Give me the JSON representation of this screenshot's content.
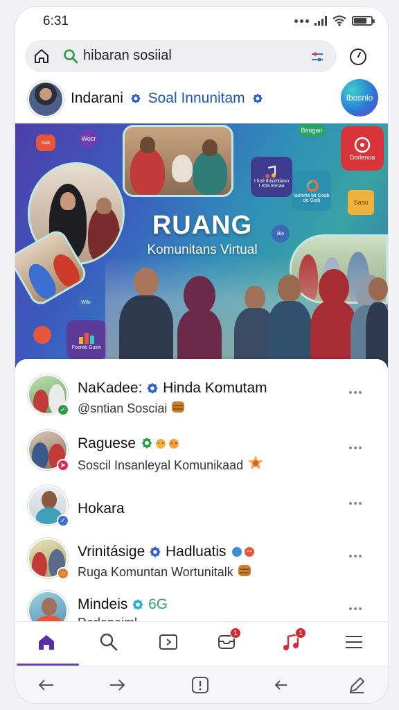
{
  "status": {
    "time": "6:31"
  },
  "search": {
    "query": "hibaran sosiial"
  },
  "profile": {
    "name": "Indarani",
    "subtitle": "Soal Innunitam",
    "brand_label": "Ibosnio"
  },
  "hero": {
    "title": "RUANG",
    "subtitle": "Komunitans Virtual",
    "chips": [
      {
        "label": "Wocr",
        "color": "#6a3fb6"
      },
      {
        "label": "Beogan",
        "color": "#2aa36b"
      },
      {
        "label": "Dorlenoa",
        "color": "#d8343a"
      },
      {
        "label": "I fusl thisimtiaun\nI Inta trivrau",
        "color": "#3d3c8f"
      },
      {
        "label": "iaelerta bit Goab\nde Guib",
        "color": "#2b8fb0"
      },
      {
        "label": "Sasu",
        "color": "#f0b23c"
      },
      {
        "label": "Foorab Gusin",
        "color": "#5b3c9a"
      },
      {
        "label": "Wilo",
        "color": "#3c6ab8"
      }
    ]
  },
  "feed": [
    {
      "title": "NaKadee:",
      "title_after": "Hinda Komutam",
      "subtitle": "@sntian Sosciai",
      "badge_color": "#2a9d4a"
    },
    {
      "title": "Raguese",
      "title_after": "",
      "subtitle": "Soscil Insanleyal Komunikaad",
      "badge_color": "#d62d5a"
    },
    {
      "title": "Hokara",
      "title_after": "",
      "subtitle": "",
      "badge_color": "#3a6fd0"
    },
    {
      "title": "Vrinitásige",
      "title_after": "Hadluatis",
      "subtitle": "Ruga Komuntan Wortunitalk",
      "badge_color": "#e07b22"
    },
    {
      "title": "Mindeis",
      "title_after": "6G",
      "subtitle": "Dorlenoiml",
      "badge_color": "#2ab0b0"
    }
  ],
  "tabs": [
    {
      "name": "home",
      "active": true
    },
    {
      "name": "search",
      "active": false
    },
    {
      "name": "video",
      "active": false
    },
    {
      "name": "inbox",
      "active": false,
      "badge": "1"
    },
    {
      "name": "music",
      "active": false,
      "badge": "1"
    },
    {
      "name": "menu",
      "active": false
    }
  ],
  "colors": {
    "accent": "#6a3fb6",
    "verified": "#2f5fc8",
    "text_blue": "#1d54b8"
  }
}
